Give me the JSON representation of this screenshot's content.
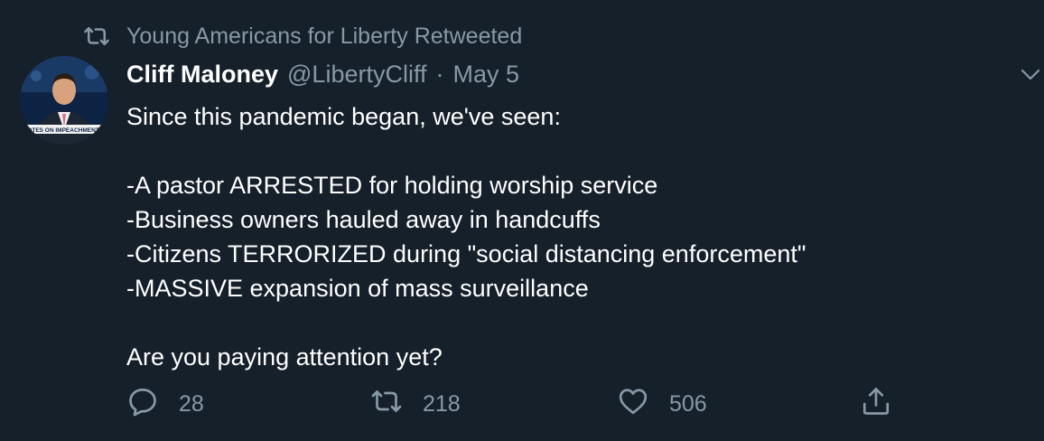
{
  "retweet_notice": {
    "text": "Young Americans for Liberty Retweeted",
    "icon": "retweet-icon"
  },
  "author": {
    "name": "Cliff Maloney",
    "handle": "@LibertyCliff",
    "separator": "·",
    "date": "May 5",
    "avatar_caption": "VOTES ON IMPEACHMENT A"
  },
  "tweet": {
    "lines": [
      "Since this pandemic began, we've seen:",
      "",
      "-A pastor ARRESTED for holding worship service",
      "-Business owners hauled away in handcuffs",
      "-Citizens TERRORIZED during \"social distancing enforcement\"",
      "-MASSIVE expansion of mass surveillance",
      "",
      "Are you paying attention yet?"
    ]
  },
  "actions": {
    "reply": {
      "icon": "reply-icon",
      "count": "28"
    },
    "retweet": {
      "icon": "retweet-icon",
      "count": "218"
    },
    "like": {
      "icon": "heart-icon",
      "count": "506"
    },
    "share": {
      "icon": "share-icon"
    }
  },
  "colors": {
    "background": "#15202b",
    "text": "#ffffff",
    "muted": "#8899a6"
  }
}
